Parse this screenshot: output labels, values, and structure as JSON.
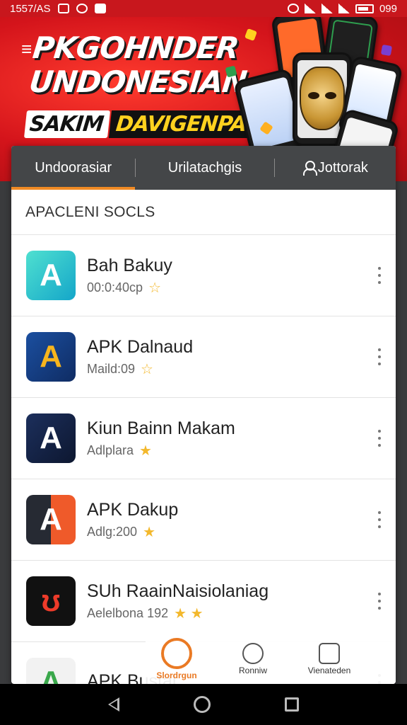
{
  "status_bar": {
    "time": "1557/AS",
    "battery": "099"
  },
  "banner": {
    "title_line1": "PKGOHNDER",
    "title_line2": "UNDONESIAN",
    "sub_white": "SAKIM",
    "sub_yellow": "DAVIGENPAR!!"
  },
  "tabs": [
    {
      "label": "Undoorasiar"
    },
    {
      "label": "Urilatachgis"
    },
    {
      "label": "Jottorak"
    }
  ],
  "section_title": "APACLENI SOCLS",
  "apps": [
    {
      "name": "Bah Bakuy",
      "meta": "00:0:40cp",
      "stars": "☆"
    },
    {
      "name": "APK Dalnaud",
      "meta": "Maild:09",
      "stars": "☆"
    },
    {
      "name": "Kiun Bainn Makam",
      "meta": "Adlplara",
      "stars": "★"
    },
    {
      "name": "APK Dakup",
      "meta": "Adlg:200",
      "stars": "★"
    },
    {
      "name": "SUh RaainNaisiolaniag",
      "meta": "Aelelbona 192",
      "stars": "★ ★"
    },
    {
      "name": "APK Bustal",
      "meta": "",
      "stars": ""
    }
  ],
  "bottom_nav": [
    {
      "label": "Slordrgun"
    },
    {
      "label": "Ronniw"
    },
    {
      "label": "Vienateden"
    }
  ],
  "colors": {
    "accent": "#f08a24",
    "banner_red": "#d4141b",
    "tab_bg": "#444648"
  }
}
